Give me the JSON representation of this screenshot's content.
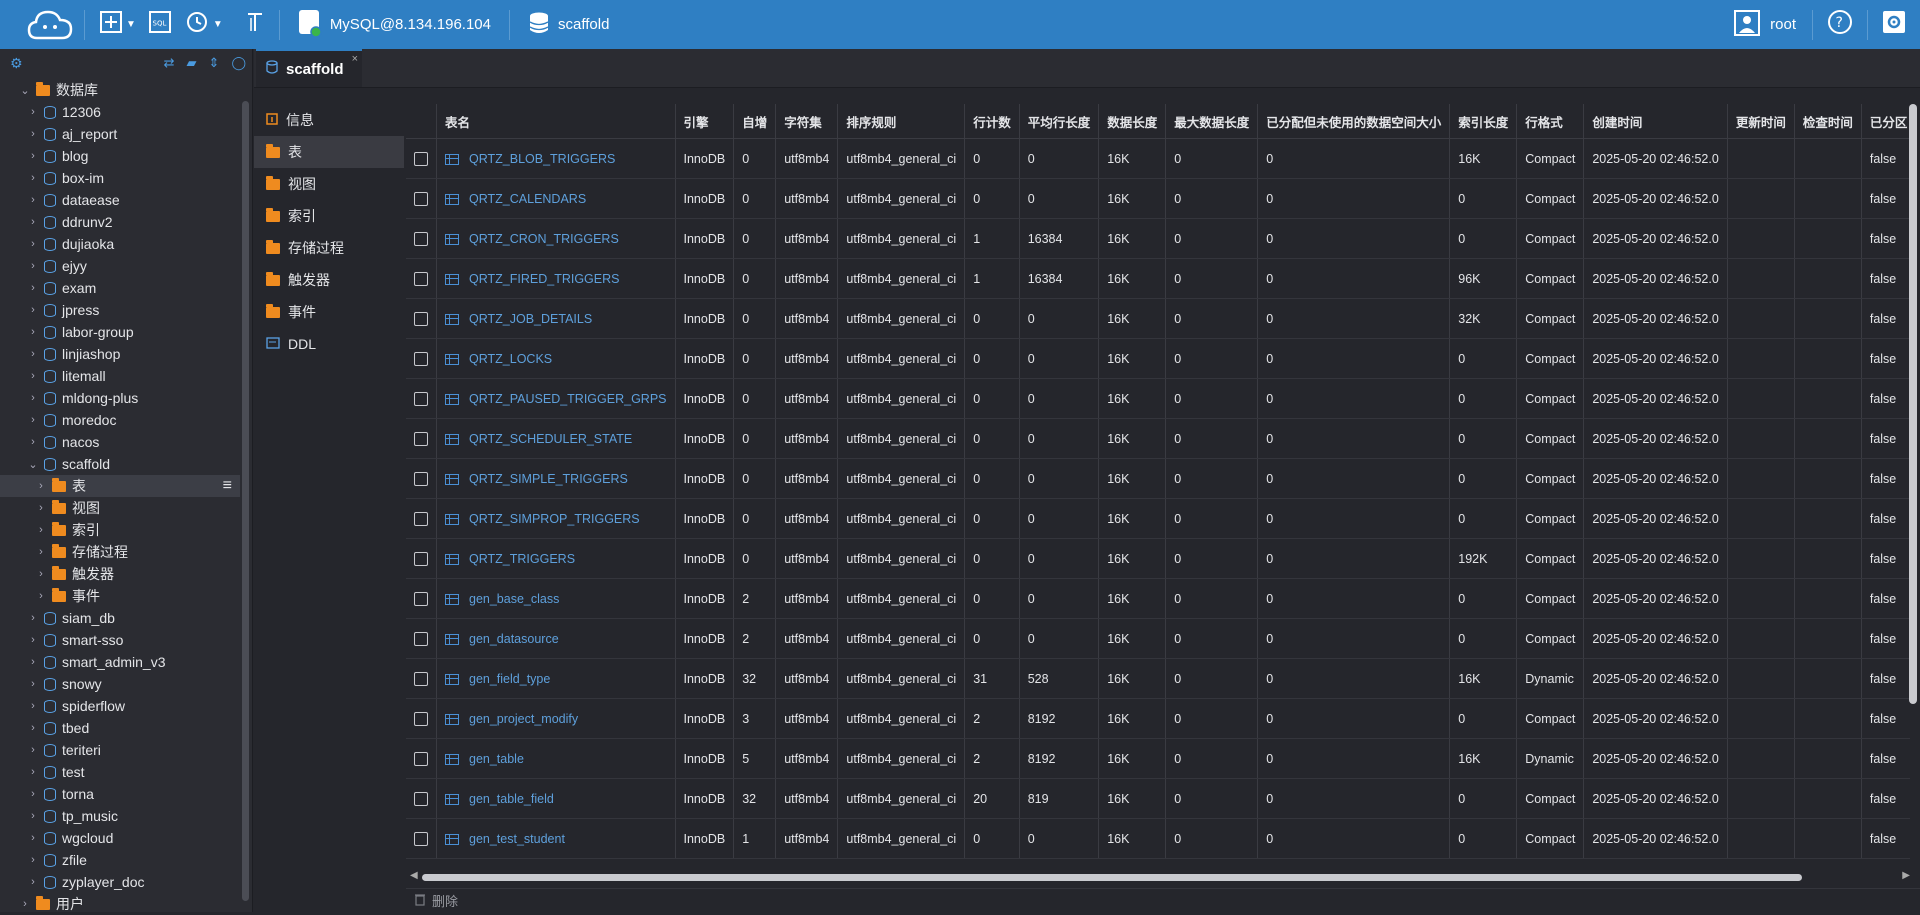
{
  "topbar": {
    "connection": "MySQL@8.134.196.104",
    "database": "scaffold",
    "user": "root",
    "icons": [
      "cloud-logo-icon",
      "new-icon",
      "sql-icon",
      "history-icon",
      "format-icon"
    ]
  },
  "sidebar": {
    "root_label": "数据库",
    "databases": [
      "12306",
      "aj_report",
      "blog",
      "box-im",
      "dataease",
      "ddrunv2",
      "dujiaoka",
      "ejyy",
      "exam",
      "jpress",
      "labor-group",
      "linjiashop",
      "litemall",
      "mldong-plus",
      "moredoc",
      "nacos",
      "scaffold"
    ],
    "scaffold_children": [
      "表",
      "视图",
      "索引",
      "存储过程",
      "触发器",
      "事件"
    ],
    "databases_after": [
      "siam_db",
      "smart-sso",
      "smart_admin_v3",
      "snowy",
      "spiderflow",
      "tbed",
      "teriteri",
      "test",
      "torna",
      "tp_music",
      "wgcloud",
      "zfile",
      "zyplayer_doc"
    ],
    "users_label": "用户"
  },
  "tab": {
    "label": "scaffold"
  },
  "nav": [
    "信息",
    "表",
    "视图",
    "索引",
    "存储过程",
    "触发器",
    "事件",
    "DDL"
  ],
  "table": {
    "headers": [
      "表名",
      "引擎",
      "自增",
      "字符集",
      "排序规则",
      "行计数",
      "平均行长度",
      "数据长度",
      "最大数据长度",
      "已分配但未使用的数据空间大小",
      "索引长度",
      "行格式",
      "创建时间",
      "更新时间",
      "检查时间",
      "已分区"
    ],
    "rows": [
      [
        "QRTZ_BLOB_TRIGGERS",
        "InnoDB",
        "0",
        "utf8mb4",
        "utf8mb4_general_ci",
        "0",
        "0",
        "16K",
        "0",
        "0",
        "16K",
        "Compact",
        "2025-05-20 02:46:52.0",
        "",
        "",
        "false"
      ],
      [
        "QRTZ_CALENDARS",
        "InnoDB",
        "0",
        "utf8mb4",
        "utf8mb4_general_ci",
        "0",
        "0",
        "16K",
        "0",
        "0",
        "0",
        "Compact",
        "2025-05-20 02:46:52.0",
        "",
        "",
        "false"
      ],
      [
        "QRTZ_CRON_TRIGGERS",
        "InnoDB",
        "0",
        "utf8mb4",
        "utf8mb4_general_ci",
        "1",
        "16384",
        "16K",
        "0",
        "0",
        "0",
        "Compact",
        "2025-05-20 02:46:52.0",
        "",
        "",
        "false"
      ],
      [
        "QRTZ_FIRED_TRIGGERS",
        "InnoDB",
        "0",
        "utf8mb4",
        "utf8mb4_general_ci",
        "1",
        "16384",
        "16K",
        "0",
        "0",
        "96K",
        "Compact",
        "2025-05-20 02:46:52.0",
        "",
        "",
        "false"
      ],
      [
        "QRTZ_JOB_DETAILS",
        "InnoDB",
        "0",
        "utf8mb4",
        "utf8mb4_general_ci",
        "0",
        "0",
        "16K",
        "0",
        "0",
        "32K",
        "Compact",
        "2025-05-20 02:46:52.0",
        "",
        "",
        "false"
      ],
      [
        "QRTZ_LOCKS",
        "InnoDB",
        "0",
        "utf8mb4",
        "utf8mb4_general_ci",
        "0",
        "0",
        "16K",
        "0",
        "0",
        "0",
        "Compact",
        "2025-05-20 02:46:52.0",
        "",
        "",
        "false"
      ],
      [
        "QRTZ_PAUSED_TRIGGER_GRPS",
        "InnoDB",
        "0",
        "utf8mb4",
        "utf8mb4_general_ci",
        "0",
        "0",
        "16K",
        "0",
        "0",
        "0",
        "Compact",
        "2025-05-20 02:46:52.0",
        "",
        "",
        "false"
      ],
      [
        "QRTZ_SCHEDULER_STATE",
        "InnoDB",
        "0",
        "utf8mb4",
        "utf8mb4_general_ci",
        "0",
        "0",
        "16K",
        "0",
        "0",
        "0",
        "Compact",
        "2025-05-20 02:46:52.0",
        "",
        "",
        "false"
      ],
      [
        "QRTZ_SIMPLE_TRIGGERS",
        "InnoDB",
        "0",
        "utf8mb4",
        "utf8mb4_general_ci",
        "0",
        "0",
        "16K",
        "0",
        "0",
        "0",
        "Compact",
        "2025-05-20 02:46:52.0",
        "",
        "",
        "false"
      ],
      [
        "QRTZ_SIMPROP_TRIGGERS",
        "InnoDB",
        "0",
        "utf8mb4",
        "utf8mb4_general_ci",
        "0",
        "0",
        "16K",
        "0",
        "0",
        "0",
        "Compact",
        "2025-05-20 02:46:52.0",
        "",
        "",
        "false"
      ],
      [
        "QRTZ_TRIGGERS",
        "InnoDB",
        "0",
        "utf8mb4",
        "utf8mb4_general_ci",
        "0",
        "0",
        "16K",
        "0",
        "0",
        "192K",
        "Compact",
        "2025-05-20 02:46:52.0",
        "",
        "",
        "false"
      ],
      [
        "gen_base_class",
        "InnoDB",
        "2",
        "utf8mb4",
        "utf8mb4_general_ci",
        "0",
        "0",
        "16K",
        "0",
        "0",
        "0",
        "Compact",
        "2025-05-20 02:46:52.0",
        "",
        "",
        "false"
      ],
      [
        "gen_datasource",
        "InnoDB",
        "2",
        "utf8mb4",
        "utf8mb4_general_ci",
        "0",
        "0",
        "16K",
        "0",
        "0",
        "0",
        "Compact",
        "2025-05-20 02:46:52.0",
        "",
        "",
        "false"
      ],
      [
        "gen_field_type",
        "InnoDB",
        "32",
        "utf8mb4",
        "utf8mb4_general_ci",
        "31",
        "528",
        "16K",
        "0",
        "0",
        "16K",
        "Dynamic",
        "2025-05-20 02:46:52.0",
        "",
        "",
        "false"
      ],
      [
        "gen_project_modify",
        "InnoDB",
        "3",
        "utf8mb4",
        "utf8mb4_general_ci",
        "2",
        "8192",
        "16K",
        "0",
        "0",
        "0",
        "Compact",
        "2025-05-20 02:46:52.0",
        "",
        "",
        "false"
      ],
      [
        "gen_table",
        "InnoDB",
        "5",
        "utf8mb4",
        "utf8mb4_general_ci",
        "2",
        "8192",
        "16K",
        "0",
        "0",
        "16K",
        "Dynamic",
        "2025-05-20 02:46:52.0",
        "",
        "",
        "false"
      ],
      [
        "gen_table_field",
        "InnoDB",
        "32",
        "utf8mb4",
        "utf8mb4_general_ci",
        "20",
        "819",
        "16K",
        "0",
        "0",
        "0",
        "Compact",
        "2025-05-20 02:46:52.0",
        "",
        "",
        "false"
      ],
      [
        "gen_test_student",
        "InnoDB",
        "1",
        "utf8mb4",
        "utf8mb4_general_ci",
        "0",
        "0",
        "16K",
        "0",
        "0",
        "0",
        "Compact",
        "2025-05-20 02:46:52.0",
        "",
        "",
        "false"
      ]
    ]
  },
  "bottom": {
    "delete_label": "删除"
  }
}
